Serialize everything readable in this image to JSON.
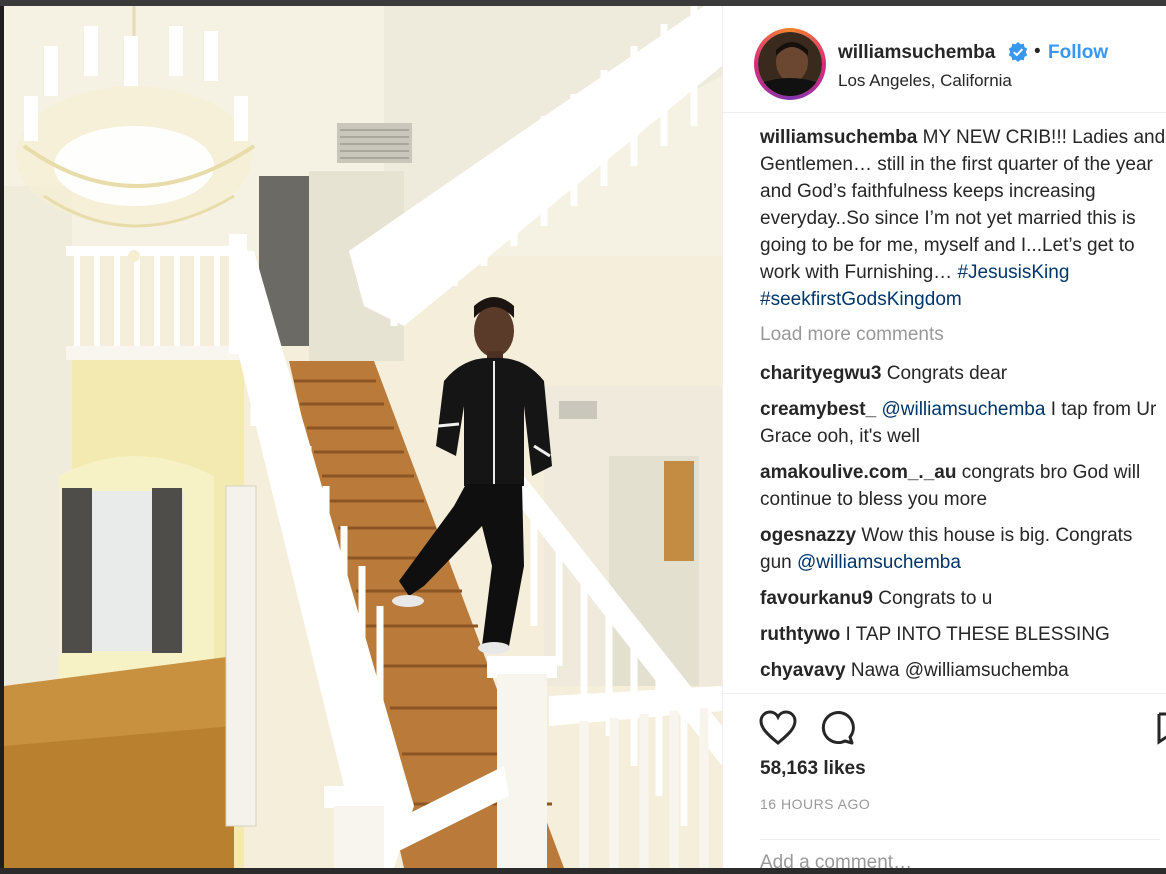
{
  "post": {
    "username": "williamsuchemba",
    "separator": "•",
    "follow_label": "Follow",
    "location": "Los Angeles, California",
    "caption": {
      "username": "williamsuchemba",
      "text": "MY NEW CRIB!!! Ladies and Gentlemen… still in the first quarter of the year and God’s faithfulness keeps increasing everyday..So since I’m not yet married this is going to be for me, myself and I...Let’s get to work with Furnishing…",
      "hashtag_1": "#JesusisKing",
      "hashtag_2": "#seekfirstGodsKingdom"
    },
    "load_more": "Load more comments",
    "comments": [
      {
        "user": "charityegwu3",
        "text": "Congrats dear"
      },
      {
        "user": "creamybest_",
        "mention": "@williamsuchemba",
        "text": "I tap from Ur Grace ooh, it's well"
      },
      {
        "user": "amakoulive.com_._au",
        "text": "congrats bro God will continue to bless you more"
      },
      {
        "user": "ogesnazzy",
        "text": "Wow this house is big. Congrats gun",
        "mention": "@williamsuchemba"
      },
      {
        "user": "favourkanu9",
        "text": "Congrats to u"
      },
      {
        "user": "ruthtywo",
        "text": "I TAP INTO THESE BLESSING"
      },
      {
        "user": "chyavavy",
        "text": "Nawa @williamsuchemba"
      }
    ],
    "likes": "58,163 likes",
    "timestamp": "16 HOURS AGO",
    "add_comment_placeholder": "Add a comment…"
  },
  "icons": {
    "verified": "verified-badge-icon",
    "like": "heart-icon",
    "comment": "comment-bubble-icon",
    "save": "bookmark-icon"
  },
  "colors": {
    "link_blue": "#3897f0",
    "mention_blue": "#003569",
    "text": "#262626",
    "muted": "#999999",
    "verified_blue": "#3897f0"
  }
}
